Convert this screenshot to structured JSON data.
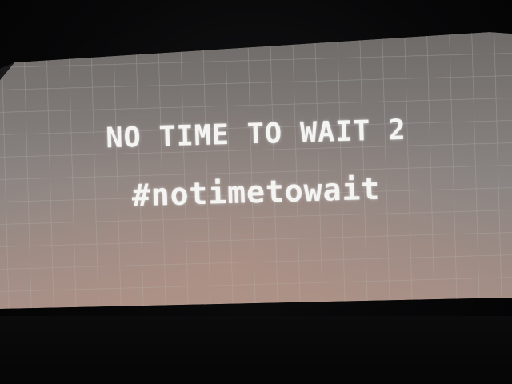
{
  "screen": {
    "headline": "NO TIME TO WAIT 2",
    "hashtag": "#notimetowait"
  },
  "colors": {
    "screen_top": "#6f6b69",
    "screen_center": "#8b8583",
    "screen_bottom": "#a58f86",
    "grid_line": "#b7b3b0",
    "text": "#f4f4f2",
    "surround": "#060607"
  }
}
